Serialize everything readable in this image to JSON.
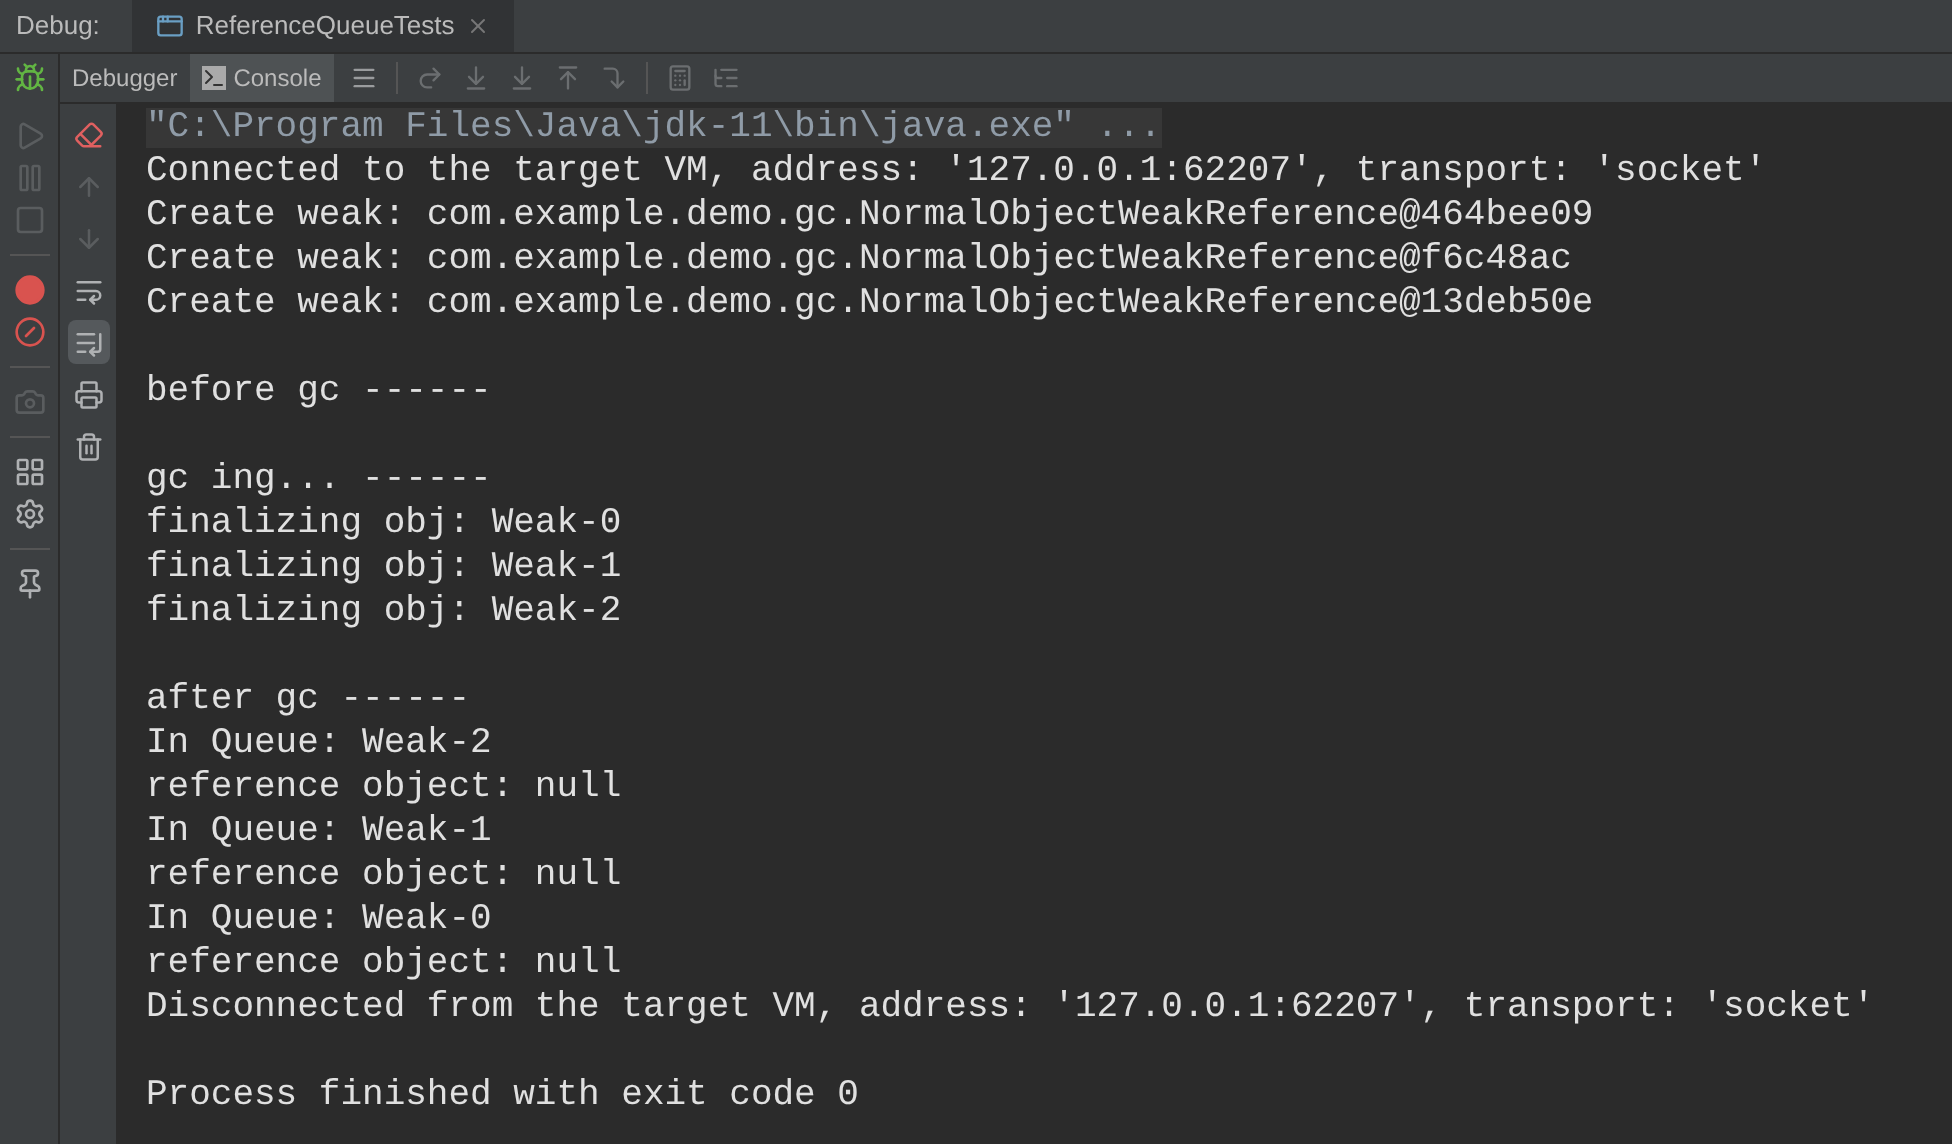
{
  "debug_bar": {
    "label": "Debug:",
    "tab": {
      "title": "ReferenceQueueTests",
      "selected": true
    }
  },
  "view_tabs": [
    {
      "label": "Debugger",
      "selected": false
    },
    {
      "label": "Console",
      "selected": true
    }
  ],
  "toolbar": [
    {
      "kind": "frames",
      "disabled": false
    },
    {
      "kind": "step-over",
      "disabled": true
    },
    {
      "kind": "step-into",
      "disabled": true
    },
    {
      "kind": "force-step-into",
      "disabled": true
    },
    {
      "kind": "step-out",
      "disabled": true
    },
    {
      "kind": "run-to-cursor",
      "disabled": true
    },
    {
      "kind": "evaluate",
      "disabled": true
    },
    {
      "kind": "trace",
      "disabled": true
    }
  ],
  "side_tools": [
    {
      "kind": "resume",
      "disabled": true
    },
    {
      "kind": "pause",
      "disabled": true
    },
    {
      "kind": "stop",
      "disabled": true
    },
    {
      "kind": "breakpoints",
      "disabled": false
    },
    {
      "kind": "mute",
      "disabled": false
    },
    {
      "kind": "camera",
      "disabled": true
    },
    {
      "kind": "layout",
      "disabled": false
    },
    {
      "kind": "settings",
      "disabled": false
    },
    {
      "kind": "pin",
      "disabled": false
    }
  ],
  "console_tools": [
    {
      "kind": "clear",
      "selected": false,
      "disabled": false
    },
    {
      "kind": "up",
      "selected": false,
      "disabled": true
    },
    {
      "kind": "down",
      "selected": false,
      "disabled": true
    },
    {
      "kind": "wrap",
      "selected": false,
      "disabled": false
    },
    {
      "kind": "scroll-end",
      "selected": true,
      "disabled": false
    },
    {
      "kind": "print",
      "selected": false,
      "disabled": false
    },
    {
      "kind": "trash",
      "selected": false,
      "disabled": false
    }
  ],
  "console_lines": [
    {
      "kind": "command",
      "text": "\"C:\\Program Files\\Java\\jdk-11\\bin\\java.exe\" ..."
    },
    {
      "kind": "output",
      "text": "Connected to the target VM, address: '127.0.0.1:62207', transport: 'socket'"
    },
    {
      "kind": "output",
      "text": "Create weak: com.example.demo.gc.NormalObjectWeakReference@464bee09"
    },
    {
      "kind": "output",
      "text": "Create weak: com.example.demo.gc.NormalObjectWeakReference@f6c48ac"
    },
    {
      "kind": "output",
      "text": "Create weak: com.example.demo.gc.NormalObjectWeakReference@13deb50e"
    },
    {
      "kind": "blank"
    },
    {
      "kind": "output",
      "text": "before gc ------"
    },
    {
      "kind": "blank"
    },
    {
      "kind": "output",
      "text": "gc ing... ------"
    },
    {
      "kind": "output",
      "text": "finalizing obj: Weak-0"
    },
    {
      "kind": "output",
      "text": "finalizing obj: Weak-1"
    },
    {
      "kind": "output",
      "text": "finalizing obj: Weak-2"
    },
    {
      "kind": "blank"
    },
    {
      "kind": "output",
      "text": "after gc ------"
    },
    {
      "kind": "output",
      "text": "In Queue: Weak-2"
    },
    {
      "kind": "output",
      "text": "reference object: null"
    },
    {
      "kind": "output",
      "text": "In Queue: Weak-1"
    },
    {
      "kind": "output",
      "text": "reference object: null"
    },
    {
      "kind": "output",
      "text": "In Queue: Weak-0"
    },
    {
      "kind": "output",
      "text": "reference object: null"
    },
    {
      "kind": "output",
      "text": "Disconnected from the target VM, address: '127.0.0.1:62207', transport: 'socket'"
    },
    {
      "kind": "blank"
    },
    {
      "kind": "output",
      "text": "Process finished with exit code 0"
    }
  ]
}
